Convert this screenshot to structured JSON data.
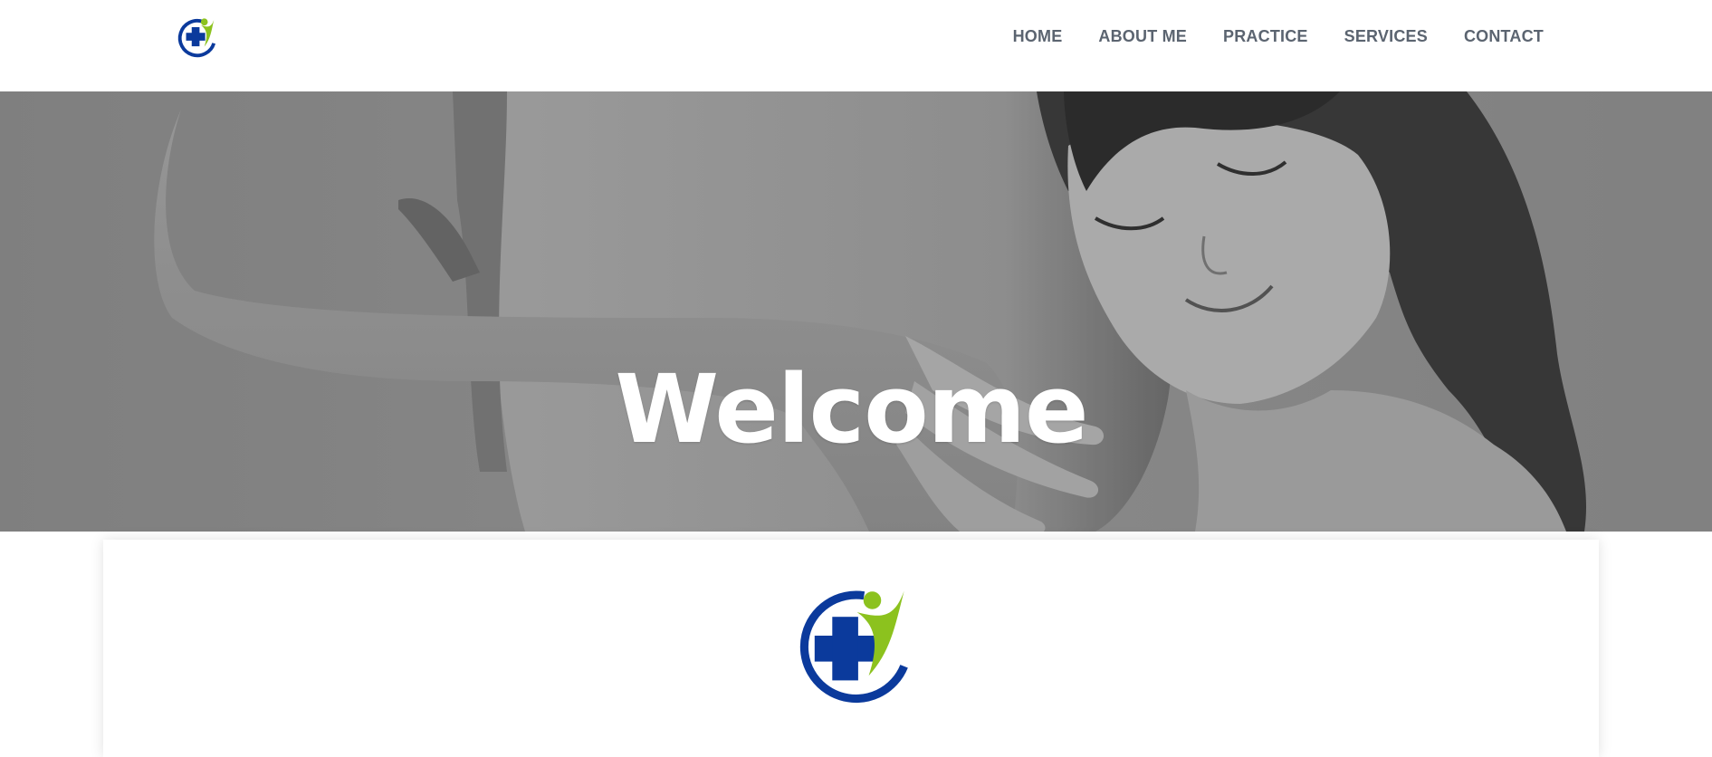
{
  "nav": {
    "items": [
      {
        "label": "HOME"
      },
      {
        "label": "ABOUT ME"
      },
      {
        "label": "PRACTICE"
      },
      {
        "label": "SERVICES"
      },
      {
        "label": "CONTACT"
      }
    ]
  },
  "hero": {
    "title": "Welcome",
    "image": "black-and-white photo of a child resting her head on a pregnant belly"
  },
  "logo": {
    "icon": "medical-cross-person-icon",
    "colors": {
      "blue": "#0b3a9c",
      "green": "#8cc21e"
    }
  }
}
